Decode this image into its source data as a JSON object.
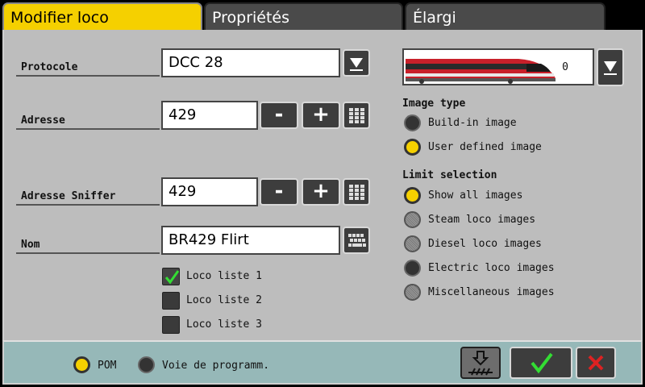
{
  "tabs": [
    {
      "label": "Modifier loco",
      "active": true
    },
    {
      "label": "Propriétés",
      "active": false
    },
    {
      "label": "Élargi",
      "active": false
    }
  ],
  "fields": {
    "protocole": {
      "label": "Protocole",
      "value": "DCC 28"
    },
    "adresse": {
      "label": "Adresse",
      "value": "429"
    },
    "adresse_sniffer": {
      "label": "Adresse Sniffer",
      "value": "429"
    },
    "nom": {
      "label": "Nom",
      "value": "BR429 Flirt"
    }
  },
  "buttons": {
    "minus": "-",
    "plus": "+"
  },
  "loco_lists": [
    {
      "label": "Loco liste 1",
      "checked": true
    },
    {
      "label": "Loco liste 2",
      "checked": false
    },
    {
      "label": "Loco liste 3",
      "checked": false
    }
  ],
  "loco_image": {
    "number": "0"
  },
  "image_type": {
    "title": "Image type",
    "options": [
      {
        "label": "Build-in image",
        "selected": false
      },
      {
        "label": "User defined image",
        "selected": true
      }
    ]
  },
  "limit_selection": {
    "title": "Limit selection",
    "options": [
      {
        "label": "Show all images",
        "selected": true,
        "enabled": true
      },
      {
        "label": "Steam loco images",
        "selected": false,
        "enabled": false
      },
      {
        "label": "Diesel loco images",
        "selected": false,
        "enabled": false
      },
      {
        "label": "Electric loco images",
        "selected": false,
        "enabled": true
      },
      {
        "label": "Miscellaneous images",
        "selected": false,
        "enabled": false
      }
    ]
  },
  "programming": {
    "options": [
      {
        "label": "POM",
        "selected": true
      },
      {
        "label": "Voie de programm.",
        "selected": false
      }
    ]
  },
  "colors": {
    "accent": "#f5d000",
    "panel": "#bdbdbd",
    "footer": "#96b8b8",
    "confirm": "#33dd33",
    "cancel": "#dd2222"
  }
}
